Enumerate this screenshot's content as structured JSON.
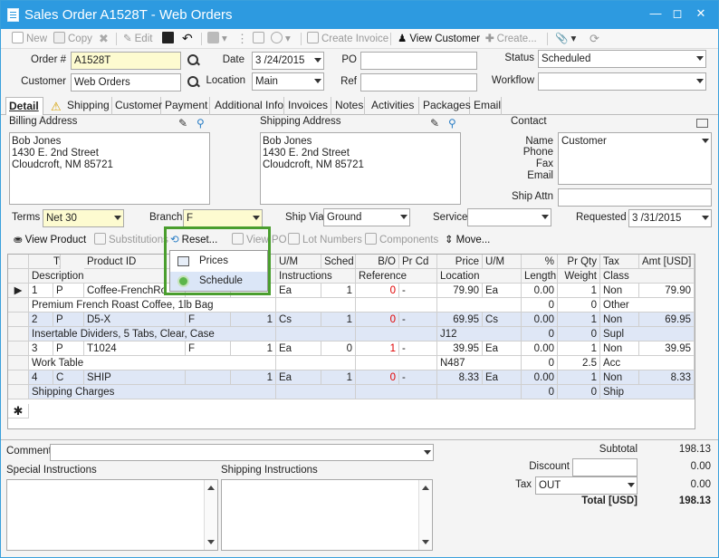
{
  "window": {
    "title": "Sales Order A1528T - Web Orders"
  },
  "toolbar": {
    "new": "New",
    "copy": "Copy",
    "edit": "Edit",
    "create_invoice": "Create Invoice",
    "view_customer": "View Customer",
    "create": "Create..."
  },
  "header": {
    "order_label": "Order #",
    "order_value": "A1528T",
    "date_label": "Date",
    "date_value": "3 /24/2015",
    "po_label": "PO",
    "po_value": "",
    "status_label": "Status",
    "status_value": "Scheduled",
    "customer_label": "Customer",
    "customer_value": "Web Orders",
    "location_label": "Location",
    "location_value": "Main",
    "ref_label": "Ref",
    "ref_value": "",
    "workflow_label": "Workflow",
    "workflow_value": ""
  },
  "tabs": [
    "Detail",
    "Shipping",
    "Customer",
    "Payment",
    "Additional Info",
    "Invoices",
    "Notes",
    "Activities",
    "Packages",
    "Email"
  ],
  "billing": {
    "label": "Billing Address",
    "lines": [
      "Bob  Jones",
      "1430 E. 2nd Street",
      "Cloudcroft, NM 85721"
    ]
  },
  "shipping": {
    "label": "Shipping Address",
    "lines": [
      "Bob  Jones",
      "1430 E. 2nd Street",
      "Cloudcroft, NM 85721"
    ]
  },
  "contact": {
    "label": "Contact",
    "name_label": "Name",
    "name_value": "Customer",
    "phone_label": "Phone",
    "fax_label": "Fax",
    "email_label": "Email",
    "ship_attn_label": "Ship Attn",
    "ship_attn_value": ""
  },
  "terms": {
    "terms_label": "Terms",
    "terms_value": "Net 30",
    "branch_label": "Branch",
    "branch_value": "F",
    "ship_via_label": "Ship Via",
    "ship_via_value": "Ground",
    "service_label": "Service",
    "service_value": "",
    "requested_label": "Requested",
    "requested_value": "3 /31/2015"
  },
  "items_toolbar": {
    "view_product": "View Product",
    "substitutions": "Substitutions",
    "reset": "Reset...",
    "view_po": "View PO",
    "lot_numbers": "Lot Numbers",
    "components": "Components",
    "move": "Move..."
  },
  "reset_menu": {
    "items": [
      "Prices",
      "Schedule"
    ]
  },
  "grid": {
    "header1": [
      "Type",
      "Product ID",
      "U/M",
      "Sched",
      "B/O",
      "Pr Cd",
      "Price",
      "U/M",
      "%",
      "Pr Qty",
      "Tax",
      "Amt [USD]"
    ],
    "header2": [
      "Description",
      "Instructions",
      "Reference",
      "Location",
      "Length",
      "Weight",
      "Class"
    ],
    "rows": [
      {
        "line": "1",
        "type": "P",
        "product": "Coffee-FrenchRo",
        "f": "",
        "qty": "",
        "um": "Ea",
        "sched": "1",
        "bo": "0",
        "prcd": "-",
        "price": "79.90",
        "um2": "Ea",
        "pct": "0.00",
        "prqty": "1",
        "tax": "Non",
        "amt": "79.90",
        "desc": "Premium French Roast Coffee, 1lb Bag",
        "location": "",
        "length": "0",
        "weight": "0",
        "class": "Other"
      },
      {
        "line": "2",
        "type": "P",
        "product": "D5-X",
        "f": "F",
        "qty": "1",
        "um": "Cs",
        "sched": "1",
        "bo": "0",
        "prcd": "-",
        "price": "69.95",
        "um2": "Cs",
        "pct": "0.00",
        "prqty": "1",
        "tax": "Non",
        "amt": "69.95",
        "desc": "Insertable Dividers, 5 Tabs, Clear, Case",
        "location": "J12",
        "length": "0",
        "weight": "0",
        "class": "Supl"
      },
      {
        "line": "3",
        "type": "P",
        "product": "T1024",
        "f": "F",
        "qty": "1",
        "um": "Ea",
        "sched": "0",
        "bo": "1",
        "prcd": "-",
        "price": "39.95",
        "um2": "Ea",
        "pct": "0.00",
        "prqty": "1",
        "tax": "Non",
        "amt": "39.95",
        "desc": "Work Table",
        "location": "N487",
        "length": "0",
        "weight": "2.5",
        "class": "Acc"
      },
      {
        "line": "4",
        "type": "C",
        "product": "SHIP",
        "f": "",
        "qty": "1",
        "um": "Ea",
        "sched": "1",
        "bo": "0",
        "prcd": "-",
        "price": "8.33",
        "um2": "Ea",
        "pct": "0.00",
        "prqty": "1",
        "tax": "Non",
        "amt": "8.33",
        "desc": "Shipping Charges",
        "location": "",
        "length": "0",
        "weight": "0",
        "class": "Ship"
      }
    ]
  },
  "footer": {
    "comment_label": "Comment",
    "special_label": "Special Instructions",
    "shipping_instr_label": "Shipping Instructions",
    "subtotal_label": "Subtotal",
    "subtotal_value": "198.13",
    "discount_label": "Discount",
    "discount_value": "0.00",
    "tax_label": "Tax",
    "tax_code": "OUT",
    "tax_value": "0.00",
    "total_label": "Total [USD]",
    "total_value": "198.13"
  },
  "colors": {
    "titlebar": "#2d9ae0",
    "highlight": "#4a9e2e",
    "alt_row": "#dfe7f6",
    "input_yellow": "#fdfbd0"
  }
}
